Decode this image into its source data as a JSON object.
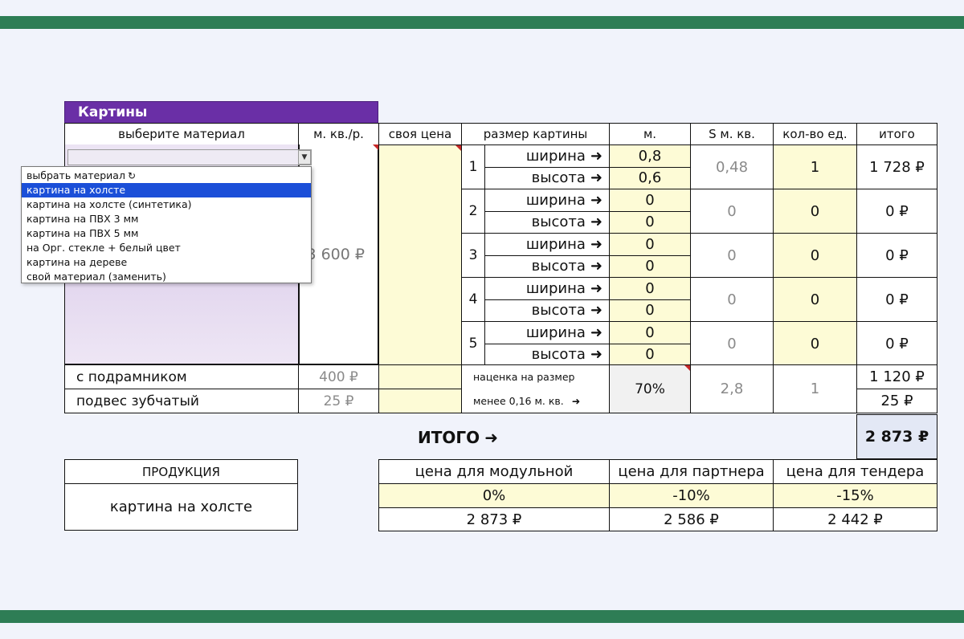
{
  "table_title": "Картины",
  "headers": {
    "material": "выберите материал",
    "m2_price": "м. кв./р.",
    "own_price": "своя цена",
    "size": "размер картины",
    "m": "м.",
    "s": "S м. кв.",
    "qty": "кол-во ед.",
    "total": "итого"
  },
  "dropdown": {
    "options": [
      "выбрать материал",
      "картина на холсте",
      "картина на холсте (синтетика)",
      "картина на ПВХ 3 мм",
      "картина на ПВХ 5 мм",
      "на Орг. стекле + белый цвет",
      "картина на дереве",
      "свой материал (заменить)"
    ],
    "selected_index": 1,
    "refresh_icon": "↻"
  },
  "m2_price_value": "3 600 ₽",
  "width_label": "ширина",
  "height_label": "высота",
  "arrow_glyph": "➜",
  "sizes": [
    {
      "num": "1",
      "width": "0,8",
      "height": "0,6",
      "area": "0,48",
      "qty": "1",
      "total": "1 728 ₽"
    },
    {
      "num": "2",
      "width": "0",
      "height": "0",
      "area": "0",
      "qty": "0",
      "total": "0 ₽"
    },
    {
      "num": "3",
      "width": "0",
      "height": "0",
      "area": "0",
      "qty": "0",
      "total": "0 ₽"
    },
    {
      "num": "4",
      "width": "0",
      "height": "0",
      "area": "0",
      "qty": "0",
      "total": "0 ₽"
    },
    {
      "num": "5",
      "width": "0",
      "height": "0",
      "area": "0",
      "qty": "0",
      "total": "0 ₽"
    }
  ],
  "extras": [
    {
      "label": "с подрамником",
      "price": "400 ₽",
      "total": "1 120 ₽"
    },
    {
      "label": "подвес зубчатый",
      "price": "25 ₽",
      "total": "25 ₽"
    }
  ],
  "markup": {
    "line1": "наценка на размер",
    "line2": "менее 0,16 м. кв.",
    "percent": "70%",
    "area": "2,8",
    "qty": "1"
  },
  "grand_total": {
    "label": "ИТОГО",
    "value": "2 873 ₽"
  },
  "product": {
    "header": "ПРОДУКЦИЯ",
    "value": "картина на холсте"
  },
  "prices": [
    {
      "label": "цена для модульной",
      "discount": "0%",
      "price": "2 873 ₽"
    },
    {
      "label": "цена для партнера",
      "discount": "-10%",
      "price": "2 586 ₽"
    },
    {
      "label": "цена для тендера",
      "discount": "-15%",
      "price": "2 442 ₽"
    }
  ]
}
